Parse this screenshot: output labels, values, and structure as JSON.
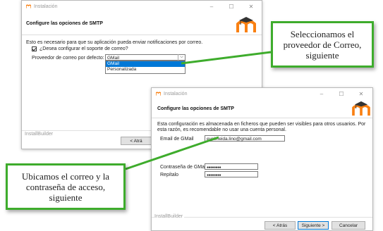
{
  "window1": {
    "title": "Instalación",
    "header_title": "Configure las opciones de SMTP",
    "info_text": "Esto es necesario para que su aplicación pueda enviar notificaciones por correo.",
    "checkbox_label": "¿Desea configurar el soporte de correo?",
    "checkbox_checked": true,
    "provider_label": "Proveedor de correo por defecto:",
    "provider_value": "GMail",
    "dropdown_options": [
      "GMail",
      "Personalizada"
    ],
    "selected_option": "GMail",
    "footer_brand": "InstallBuilder",
    "back_button": "< Atrá"
  },
  "window2": {
    "title": "Instalación",
    "header_title": "Configure las opciones de SMTP",
    "info_text": "Esta configuración es almacenada en ficheros que pueden ser visibles para otros usuarios. Por esta razón, es recomendable no usar una cuenta personal.",
    "email_label": "Email de GMail",
    "email_value": "evalmeida.lino@gmail.com",
    "password_label": "Contraseña de GMail",
    "password_value": "●●●●●●●●",
    "repeat_label": "Repítalo",
    "repeat_value": "●●●●●●●●",
    "footer_brand": "InstallBuilder",
    "back_button": "< Atrás",
    "next_button": "Siguiente >",
    "cancel_button": "Cancelar"
  },
  "callout_top": {
    "text": "Seleccionamos el proveedor de Correo, siguiente"
  },
  "callout_bottom": {
    "text": "Ubicamos el correo y la contraseña de acceso, siguiente"
  },
  "colors": {
    "callout_border": "#3eac2c",
    "selection": "#0078d7",
    "logo_orange": "#f98012"
  }
}
